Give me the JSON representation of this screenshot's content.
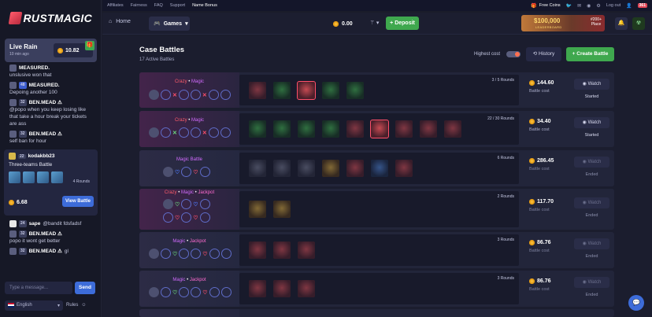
{
  "brand": {
    "name": "RUSTMAGIC"
  },
  "top_strip": {
    "links": [
      "Affiliates",
      "Fairness",
      "FAQ",
      "Support",
      "Name Bonus"
    ],
    "free_coins": "Free Coins",
    "logout": "Log out",
    "badge": "361"
  },
  "nav": {
    "home": "Home",
    "games": "Games",
    "balance": "0.00",
    "deposit": "Deposit",
    "promo": {
      "amount": "$100,000",
      "label": "LEADERBOARD",
      "place_top": "#200+",
      "place_bottom": "Place"
    }
  },
  "sidebar": {
    "rain": {
      "title": "Live Rain",
      "time": "10 min ago",
      "amount": "10.82"
    },
    "messages": [
      {
        "user": "MEASURED.",
        "level": "",
        "text": "unslusive won that"
      },
      {
        "user": "MEASURED.",
        "level": "48",
        "text": "Depoing another 100"
      },
      {
        "user": "BEN.MEAD ⚠",
        "level": "32",
        "text": "@popo when you keep losing like that take a hour break your tickets are ass"
      },
      {
        "user": "BEN.MEAD ⚠",
        "level": "32",
        "text": "self ban for hour"
      },
      {
        "user": "kodakbb23",
        "level": "22",
        "text": ""
      }
    ],
    "battle_card": {
      "title": "Three-teams Battle",
      "rounds": "4 Rounds",
      "price": "6.68",
      "button": "View Battle"
    },
    "messages_after": [
      {
        "user": "sape",
        "level": "24",
        "text": "@bandit fdsfadsf"
      },
      {
        "user": "BEN.MEAD ⚠",
        "level": "32",
        "text": "popo it wont get better"
      },
      {
        "user": "BEN.MEAD ⚠",
        "level": "32",
        "text": "gl"
      }
    ],
    "input_placeholder": "Type a message...",
    "send": "Send",
    "language": "English",
    "rules": "Rules"
  },
  "page": {
    "title": "Case Battles",
    "subtitle": "17 Active Battles",
    "highest_cost": "Highest cost",
    "history": "History",
    "create": "Create Battle"
  },
  "battles": [
    {
      "mode": [
        "Crazy",
        "Magic",
        ""
      ],
      "rounds": "3 / 5 Rounds",
      "price": "144.60",
      "cost_label": "Battle cost",
      "action": "Watch",
      "status": "Started"
    },
    {
      "mode": [
        "Crazy",
        "Magic",
        ""
      ],
      "rounds": "22 / 30 Rounds",
      "price": "34.40",
      "cost_label": "Battle cost",
      "action": "Watch",
      "status": "Started"
    },
    {
      "mode": [
        "",
        "Magic Battle",
        ""
      ],
      "rounds": "6 Rounds",
      "price": "286.45",
      "cost_label": "Battle cost",
      "action": "Watch",
      "status": "Ended"
    },
    {
      "mode": [
        "Crazy",
        "Magic",
        "Jackpot"
      ],
      "rounds": "2 Rounds",
      "price": "117.70",
      "cost_label": "Battle cost",
      "action": "Watch",
      "status": "Ended"
    },
    {
      "mode": [
        "",
        "Magic",
        "Jackpot"
      ],
      "rounds": "3 Rounds",
      "price": "86.76",
      "cost_label": "Battle cost",
      "action": "Watch",
      "status": "Ended"
    },
    {
      "mode": [
        "",
        "Magic",
        "Jackpot"
      ],
      "rounds": "3 Rounds",
      "price": "86.76",
      "cost_label": "Battle cost",
      "action": "Watch",
      "status": "Ended"
    }
  ],
  "colors": {
    "accent_green": "#3fa84e",
    "accent_blue": "#3d6cd9",
    "crazy": "#ff5b6b",
    "magic": "#d26bff"
  }
}
